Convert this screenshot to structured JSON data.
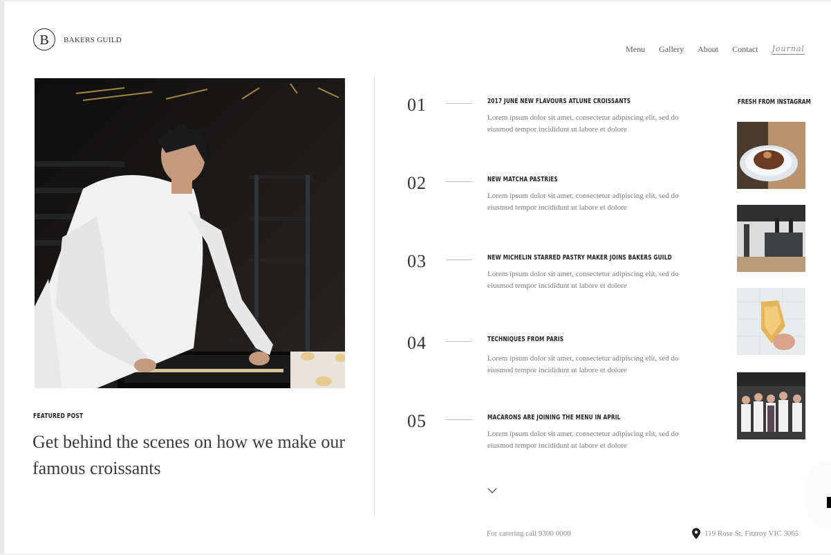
{
  "brand": {
    "logo_letter": "B",
    "name": "BAKERS GUILD"
  },
  "nav": {
    "items": [
      "Menu",
      "Gallery",
      "About",
      "Contact"
    ],
    "journal_label": "Journal"
  },
  "featured": {
    "label": "FEATURED POST",
    "title": "Get behind the scenes on how we make our famous croissants"
  },
  "posts": [
    {
      "number": "01",
      "title": "2017 JUNE NEW FLAVOURS ATLUNE CROISSANTS",
      "excerpt": "Lorem ipsum dolor sit amet, consectetur adipiscing elit, sed do eiusmod tempor incididunt ut labore et dolore"
    },
    {
      "number": "02",
      "title": "NEW MATCHA PASTRIES",
      "excerpt": "Lorem ipsum dolor sit amet, consectetur adipiscing elit, sed do eiusmod tempor incididunt ut labore et dolore"
    },
    {
      "number": "03",
      "title": "NEW MICHELIN STARRED PASTRY MAKER JOINS BAKERS GUILD",
      "excerpt": "Lorem ipsum dolor sit amet, consectetur adipiscing elit, sed do eiusmod tempor incididunt ut labore et dolore"
    },
    {
      "number": "04",
      "title": "TECHNIQUES FROM PARIS",
      "excerpt": "Lorem ipsum dolor sit amet, consectetur adipiscing elit, sed do eiusmod tempor incididunt ut labore et dolore"
    },
    {
      "number": "05",
      "title": "MACARONS ARE JOINING THE MENU IN APRIL",
      "excerpt": "Lorem ipsum dolor sit amet, consectetur adipiscing elit, sed do eiusmod tempor incididunt ut labore et dolore"
    }
  ],
  "instagram": {
    "title": "FRESH FROM INSTAGRAM"
  },
  "footer": {
    "catering": "For catering call 9300 0000",
    "address": "119 Rose St, Fitzroy VIC 3065"
  },
  "icons": {
    "scroll": "chevron-down-icon",
    "location": "map-pin-icon"
  },
  "colors": {
    "text": "#333333",
    "muted": "#888888",
    "hero_bg": "#141414"
  }
}
